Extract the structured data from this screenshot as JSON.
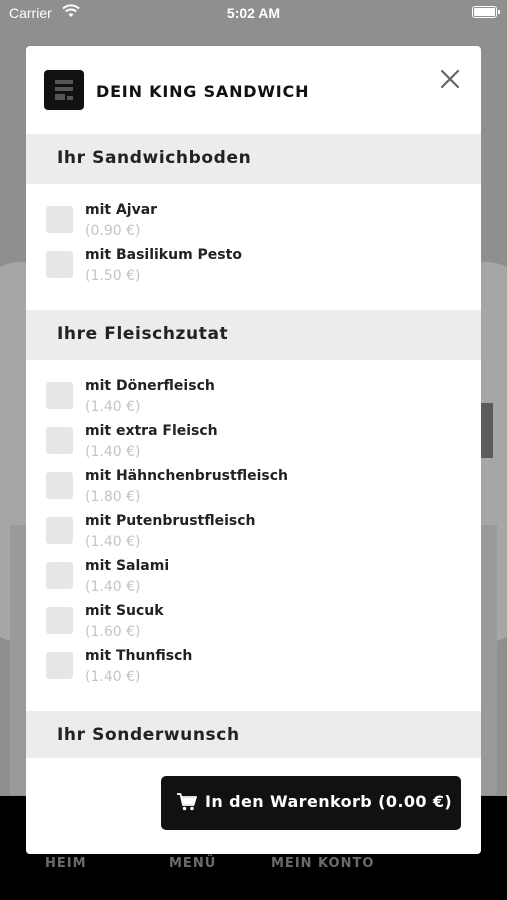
{
  "status_bar": {
    "carrier": "Carrier",
    "time": "5:02 AM"
  },
  "modal": {
    "title": "DEIN KING SANDWICH",
    "sections": [
      {
        "title": "Ihr Sandwichboden",
        "options": [
          {
            "name": "mit Ajvar",
            "price": "(0.90 €)"
          },
          {
            "name": "mit Basilikum Pesto",
            "price": "(1.50 €)"
          }
        ]
      },
      {
        "title": "Ihre Fleischzutat",
        "options": [
          {
            "name": "mit Dönerfleisch",
            "price": "(1.40 €)"
          },
          {
            "name": "mit extra Fleisch",
            "price": "(1.40 €)"
          },
          {
            "name": "mit Hähnchenbrustfleisch",
            "price": "(1.80 €)"
          },
          {
            "name": "mit Putenbrustfleisch",
            "price": "(1.40 €)"
          },
          {
            "name": "mit Salami",
            "price": "(1.40 €)"
          },
          {
            "name": "mit Sucuk",
            "price": "(1.60 €)"
          },
          {
            "name": "mit Thunfisch",
            "price": "(1.40 €)"
          }
        ]
      },
      {
        "title": "Ihr Sonderwunsch",
        "options": []
      }
    ],
    "cart_button_label": "In den Warenkorb (0.00 €)"
  },
  "tab_bar": {
    "items": [
      {
        "label": "HEIM"
      },
      {
        "label": "MENÜ"
      },
      {
        "label": "MEIN KONTO"
      }
    ]
  },
  "colors": {
    "accent": "#111111",
    "section_bg": "#ececec",
    "checkbox_bg": "#e6e6e6",
    "price_text": "#c4c4c4",
    "overlay_bg": "#8f8f8f"
  }
}
